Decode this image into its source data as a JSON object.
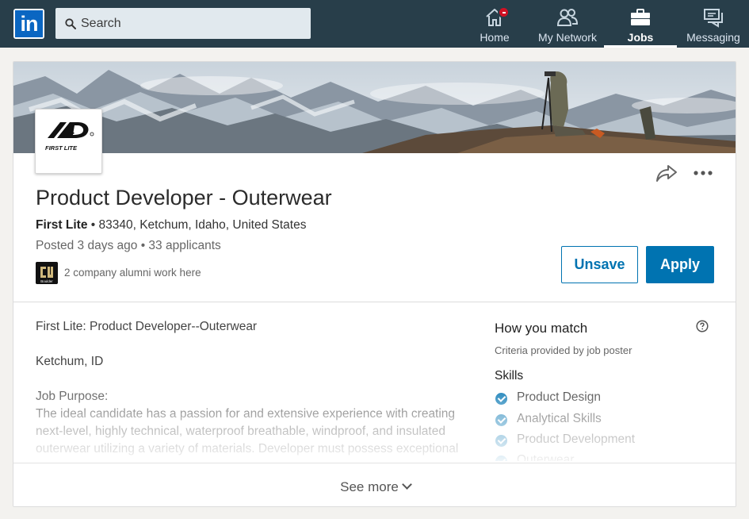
{
  "nav": {
    "search_placeholder": "Search",
    "items": [
      {
        "label": "Home",
        "icon": "home-icon",
        "has_notification": true
      },
      {
        "label": "My Network",
        "icon": "network-icon"
      },
      {
        "label": "Jobs",
        "icon": "briefcase-icon",
        "active": true
      },
      {
        "label": "Messaging",
        "icon": "messaging-icon"
      }
    ]
  },
  "job": {
    "title": "Product Developer - Outerwear",
    "company": "First Lite",
    "separator": " • ",
    "location": "83340, Ketchum, Idaho, United States",
    "posted": "Posted 3 days ago • 33 applicants",
    "alumni": "2 company alumni work here",
    "company_logo_text": "FIRST LITE",
    "alumni_logo_text": "Boulder",
    "unsave_label": "Unsave",
    "apply_label": "Apply"
  },
  "description": {
    "line1": "First Lite: Product Developer--Outerwear",
    "line2": "Ketchum, ID",
    "purpose_heading": "Job Purpose:",
    "purpose_text": "The ideal candidate has a passion for and extensive experience with creating next-level, highly technical, waterproof breathable, windproof, and insulated outerwear utilizing a variety of materials. Developer must possess exceptional"
  },
  "match": {
    "title": "How you match",
    "criteria": "Criteria provided by job poster",
    "skills_heading": "Skills",
    "skills": [
      "Product Design",
      "Analytical Skills",
      "Product Development",
      "Outerwear"
    ]
  },
  "see_more_label": "See more",
  "colors": {
    "nav_bg": "#283e4a",
    "brand_blue": "#0073b1",
    "notification": "#d11124"
  }
}
